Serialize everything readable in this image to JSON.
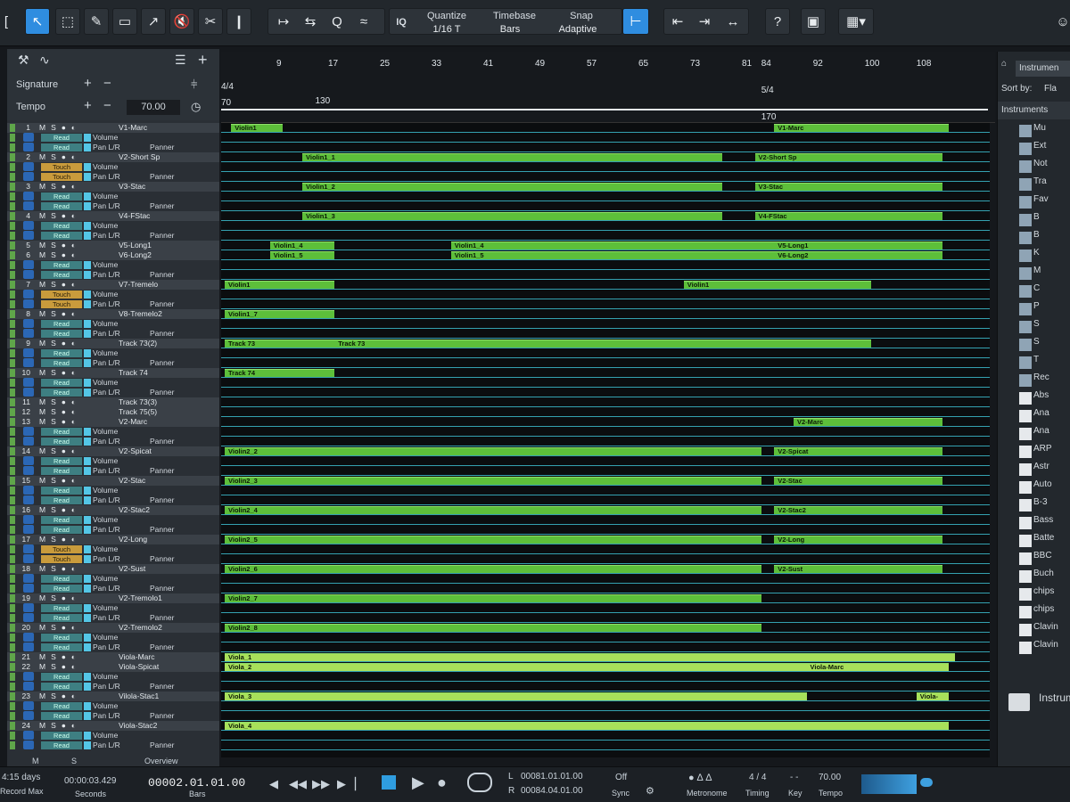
{
  "toolbar": {
    "quantize_label": "Quantize",
    "quantize_value": "1/16 T",
    "timebase_label": "Timebase",
    "timebase_value": "Bars",
    "snap_label": "Snap",
    "snap_value": "Adaptive",
    "iq_label": "IQ",
    "help_label": "?"
  },
  "panel": {
    "signature_label": "Signature",
    "tempo_label": "Tempo",
    "tempo_value": "70.00"
  },
  "ruler": {
    "bars": [
      "9",
      "17",
      "25",
      "33",
      "41",
      "49",
      "57",
      "65",
      "73",
      "81",
      "84",
      "92",
      "100",
      "108"
    ],
    "sig_start": "4/4",
    "sig_change": "5/4",
    "tempo_start": "70",
    "tempo_mark": "130",
    "tempo_end": "170"
  },
  "tracks": [
    {
      "kind": "track",
      "num": "1",
      "name": "V1-Marc"
    },
    {
      "kind": "auto",
      "mode": "Read",
      "param": "Volume"
    },
    {
      "kind": "auto",
      "mode": "Read",
      "param": "Pan L/R",
      "panner": "Panner"
    },
    {
      "kind": "track",
      "num": "2",
      "name": "V2-Short Sp"
    },
    {
      "kind": "auto",
      "mode": "Touch",
      "param": "Volume"
    },
    {
      "kind": "auto",
      "mode": "Touch",
      "param": "Pan L/R",
      "panner": "Panner"
    },
    {
      "kind": "track",
      "num": "3",
      "name": "V3-Stac"
    },
    {
      "kind": "auto",
      "mode": "Read",
      "param": "Volume"
    },
    {
      "kind": "auto",
      "mode": "Read",
      "param": "Pan L/R",
      "panner": "Panner"
    },
    {
      "kind": "track",
      "num": "4",
      "name": "V4-FStac"
    },
    {
      "kind": "auto",
      "mode": "Read",
      "param": "Volume"
    },
    {
      "kind": "auto",
      "mode": "Read",
      "param": "Pan L/R",
      "panner": "Panner"
    },
    {
      "kind": "track",
      "num": "5",
      "name": "V5-Long1"
    },
    {
      "kind": "track",
      "num": "6",
      "name": "V6-Long2"
    },
    {
      "kind": "auto",
      "mode": "Read",
      "param": "Volume"
    },
    {
      "kind": "auto",
      "mode": "Read",
      "param": "Pan L/R",
      "panner": "Panner"
    },
    {
      "kind": "track",
      "num": "7",
      "name": "V7-Tremelo"
    },
    {
      "kind": "auto",
      "mode": "Touch",
      "param": "Volume"
    },
    {
      "kind": "auto",
      "mode": "Touch",
      "param": "Pan L/R",
      "panner": "Panner"
    },
    {
      "kind": "track",
      "num": "8",
      "name": "V8-Tremelo2"
    },
    {
      "kind": "auto",
      "mode": "Read",
      "param": "Volume"
    },
    {
      "kind": "auto",
      "mode": "Read",
      "param": "Pan L/R",
      "panner": "Panner"
    },
    {
      "kind": "track",
      "num": "9",
      "name": "Track 73(2)"
    },
    {
      "kind": "auto",
      "mode": "Read",
      "param": "Volume"
    },
    {
      "kind": "auto",
      "mode": "Read",
      "param": "Pan L/R",
      "panner": "Panner"
    },
    {
      "kind": "track",
      "num": "10",
      "name": "Track 74"
    },
    {
      "kind": "auto",
      "mode": "Read",
      "param": "Volume"
    },
    {
      "kind": "auto",
      "mode": "Read",
      "param": "Pan L/R",
      "panner": "Panner"
    },
    {
      "kind": "track",
      "num": "11",
      "name": "Track 73(3)"
    },
    {
      "kind": "track",
      "num": "12",
      "name": "Track 75(5)"
    },
    {
      "kind": "track",
      "num": "13",
      "name": "V2-Marc"
    },
    {
      "kind": "auto",
      "mode": "Read",
      "param": "Volume"
    },
    {
      "kind": "auto",
      "mode": "Read",
      "param": "Pan L/R",
      "panner": "Panner"
    },
    {
      "kind": "track",
      "num": "14",
      "name": "V2-Spicat"
    },
    {
      "kind": "auto",
      "mode": "Read",
      "param": "Volume"
    },
    {
      "kind": "auto",
      "mode": "Read",
      "param": "Pan L/R",
      "panner": "Panner"
    },
    {
      "kind": "track",
      "num": "15",
      "name": "V2-Stac"
    },
    {
      "kind": "auto",
      "mode": "Read",
      "param": "Volume"
    },
    {
      "kind": "auto",
      "mode": "Read",
      "param": "Pan L/R",
      "panner": "Panner"
    },
    {
      "kind": "track",
      "num": "16",
      "name": "V2-Stac2"
    },
    {
      "kind": "auto",
      "mode": "Read",
      "param": "Volume"
    },
    {
      "kind": "auto",
      "mode": "Read",
      "param": "Pan L/R",
      "panner": "Panner"
    },
    {
      "kind": "track",
      "num": "17",
      "name": "V2-Long"
    },
    {
      "kind": "auto",
      "mode": "Touch",
      "param": "Volume"
    },
    {
      "kind": "auto",
      "mode": "Touch",
      "param": "Pan L/R",
      "panner": "Panner"
    },
    {
      "kind": "track",
      "num": "18",
      "name": "V2-Sust"
    },
    {
      "kind": "auto",
      "mode": "Read",
      "param": "Volume"
    },
    {
      "kind": "auto",
      "mode": "Read",
      "param": "Pan L/R",
      "panner": "Panner"
    },
    {
      "kind": "track",
      "num": "19",
      "name": "V2-Tremolo1"
    },
    {
      "kind": "auto",
      "mode": "Read",
      "param": "Volume"
    },
    {
      "kind": "auto",
      "mode": "Read",
      "param": "Pan L/R",
      "panner": "Panner"
    },
    {
      "kind": "track",
      "num": "20",
      "name": "V2-Tremolo2"
    },
    {
      "kind": "auto",
      "mode": "Read",
      "param": "Volume"
    },
    {
      "kind": "auto",
      "mode": "Read",
      "param": "Pan L/R",
      "panner": "Panner"
    },
    {
      "kind": "track",
      "num": "21",
      "name": "Viola-Marc"
    },
    {
      "kind": "track",
      "num": "22",
      "name": "Viola-Spicat"
    },
    {
      "kind": "auto",
      "mode": "Read",
      "param": "Volume"
    },
    {
      "kind": "auto",
      "mode": "Read",
      "param": "Pan L/R",
      "panner": "Panner"
    },
    {
      "kind": "track",
      "num": "23",
      "name": "Vilola-Stac1"
    },
    {
      "kind": "auto",
      "mode": "Read",
      "param": "Volume"
    },
    {
      "kind": "auto",
      "mode": "Read",
      "param": "Pan L/R",
      "panner": "Panner"
    },
    {
      "kind": "track",
      "num": "24",
      "name": "Viola-Stac2"
    },
    {
      "kind": "auto",
      "mode": "Read",
      "param": "Volume"
    },
    {
      "kind": "auto",
      "mode": "Read",
      "param": "Pan L/R",
      "panner": "Panner"
    }
  ],
  "clips": [
    {
      "row": 0,
      "label": "Violin1",
      "start": 2,
      "len": 8
    },
    {
      "row": 0,
      "label": "V1-Marc",
      "start": 86,
      "len": 27
    },
    {
      "row": 3,
      "label": "Violin1_1",
      "start": 13,
      "len": 65
    },
    {
      "row": 3,
      "label": "V2-Short Sp",
      "start": 83,
      "len": 29
    },
    {
      "row": 6,
      "label": "Violin1_2",
      "start": 13,
      "len": 65
    },
    {
      "row": 6,
      "label": "V3-Stac",
      "start": 83,
      "len": 29
    },
    {
      "row": 9,
      "label": "Violin1_3",
      "start": 13,
      "len": 65
    },
    {
      "row": 9,
      "label": "V4-FStac",
      "start": 83,
      "len": 29
    },
    {
      "row": 12,
      "label": "Violin1_4",
      "start": 8,
      "len": 10
    },
    {
      "row": 12,
      "label": "Violin1_4",
      "start": 36,
      "len": 53
    },
    {
      "row": 12,
      "label": "V5-Long1",
      "start": 86,
      "len": 26
    },
    {
      "row": 13,
      "label": "Violin1_5",
      "start": 8,
      "len": 10
    },
    {
      "row": 13,
      "label": "Violin1_5",
      "start": 36,
      "len": 53
    },
    {
      "row": 13,
      "label": "V6-Long2",
      "start": 86,
      "len": 26
    },
    {
      "row": 16,
      "label": "Violin1",
      "start": 1,
      "len": 17
    },
    {
      "row": 16,
      "label": "Violin1",
      "start": 72,
      "len": 29
    },
    {
      "row": 19,
      "label": "Violin1_7",
      "start": 1,
      "len": 17
    },
    {
      "row": 22,
      "label": "Track 73",
      "start": 1,
      "len": 17
    },
    {
      "row": 22,
      "label": "Track 73",
      "start": 18,
      "len": 83
    },
    {
      "row": 25,
      "label": "Track 74",
      "start": 1,
      "len": 17
    },
    {
      "row": 30,
      "label": "V2-Marc",
      "start": 89,
      "len": 23
    },
    {
      "row": 33,
      "label": "Violin2_2",
      "start": 1,
      "len": 83
    },
    {
      "row": 33,
      "label": "V2-Spicat",
      "start": 86,
      "len": 26
    },
    {
      "row": 36,
      "label": "Violin2_3",
      "start": 1,
      "len": 83
    },
    {
      "row": 36,
      "label": "V2-Stac",
      "start": 86,
      "len": 26
    },
    {
      "row": 39,
      "label": "Violin2_4",
      "start": 1,
      "len": 83
    },
    {
      "row": 39,
      "label": "V2-Stac2",
      "start": 86,
      "len": 26
    },
    {
      "row": 42,
      "label": "Violin2_5",
      "start": 1,
      "len": 83
    },
    {
      "row": 42,
      "label": "V2-Long",
      "start": 86,
      "len": 26
    },
    {
      "row": 45,
      "label": "Violin2_6",
      "start": 1,
      "len": 83
    },
    {
      "row": 45,
      "label": "V2-Sust",
      "start": 86,
      "len": 26
    },
    {
      "row": 48,
      "label": "Violin2_7",
      "start": 1,
      "len": 83
    },
    {
      "row": 51,
      "label": "Violin2_8",
      "start": 1,
      "len": 83
    },
    {
      "row": 54,
      "label": "Viola_1",
      "start": 1,
      "len": 113
    },
    {
      "row": 55,
      "label": "Viola_2",
      "start": 1,
      "len": 90
    },
    {
      "row": 55,
      "label": "Viola-Marc",
      "start": 91,
      "len": 22
    },
    {
      "row": 58,
      "label": "Viola_3",
      "start": 1,
      "len": 90
    },
    {
      "row": 58,
      "label": "Viola-",
      "start": 108,
      "len": 5
    },
    {
      "row": 61,
      "label": "Viola_4",
      "start": 1,
      "len": 112
    }
  ],
  "browser": {
    "title": "Instrumen",
    "sort_label": "Sort by:",
    "sort_value": "Fla",
    "category": "Instruments",
    "items": [
      "Mu",
      "Ext",
      "Not",
      "Tra",
      "Fav",
      "B",
      "B",
      "K",
      "M",
      "C",
      "P",
      "S",
      "S",
      "T",
      "Rec",
      "Abs",
      "Ana",
      "Ana",
      "ARP",
      "Astr",
      "Auto",
      "B-3",
      "Bass",
      "Batte",
      "BBC",
      "Buch",
      "chips",
      "chips",
      "Clavin",
      "Clavin"
    ],
    "footer": "Instrum"
  },
  "transport": {
    "days": "4:15 days",
    "record_max": "Record Max",
    "seconds_value": "00:00:03.429",
    "seconds_label": "Seconds",
    "bars_value": "00002.01.01.00",
    "bars_label": "Bars",
    "left_locator": "00081.01.01.00",
    "right_locator": "00084.04.01.00",
    "l_label": "L",
    "r_label": "R",
    "sync_value": "Off",
    "sync_label": "Sync",
    "metronome_label": "Metronome",
    "timing_value": "4 / 4",
    "timing_label": "Timing",
    "key_value": "- -",
    "key_label": "Key",
    "tempo_value": "70.00",
    "tempo_label": "Tempo",
    "m_label": "M",
    "s_label": "S",
    "overview_label": "Overview"
  }
}
